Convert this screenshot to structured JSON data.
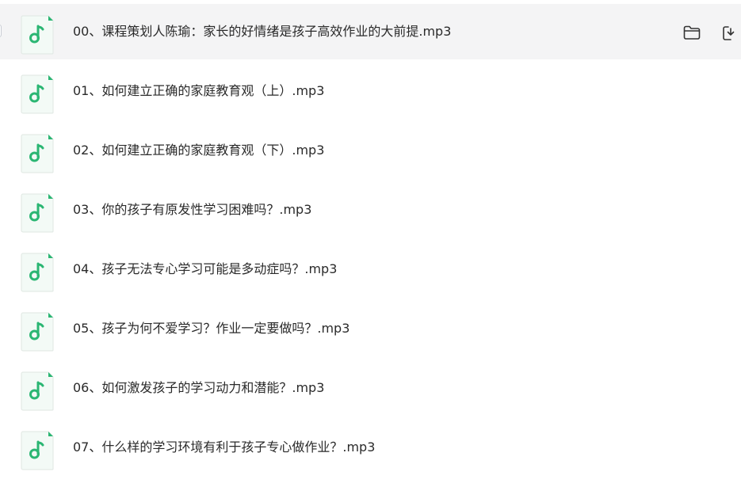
{
  "colors": {
    "row_hover_bg": "#f4f4f5",
    "text": "#2a2a2a",
    "icon_green": "#2bb673",
    "icon_bg": "#f3faf6"
  },
  "files": [
    {
      "name": "00、课程策划人陈瑜：家长的好情绪是孩子高效作业的大前提.mp3",
      "icon": "audio-file-icon",
      "hovered": true
    },
    {
      "name": "01、如何建立正确的家庭教育观（上）.mp3",
      "icon": "audio-file-icon"
    },
    {
      "name": "02、如何建立正确的家庭教育观（下）.mp3",
      "icon": "audio-file-icon"
    },
    {
      "name": "03、你的孩子有原发性学习困难吗？.mp3",
      "icon": "audio-file-icon"
    },
    {
      "name": "04、孩子无法专心学习可能是多动症吗？.mp3",
      "icon": "audio-file-icon"
    },
    {
      "name": "05、孩子为何不爱学习？作业一定要做吗？.mp3",
      "icon": "audio-file-icon"
    },
    {
      "name": "06、如何激发孩子的学习动力和潜能？.mp3",
      "icon": "audio-file-icon"
    },
    {
      "name": "07、什么样的学习环境有利于孩子专心做作业？.mp3",
      "icon": "audio-file-icon"
    }
  ],
  "row_actions": [
    "folder-icon",
    "save-to-icon"
  ]
}
